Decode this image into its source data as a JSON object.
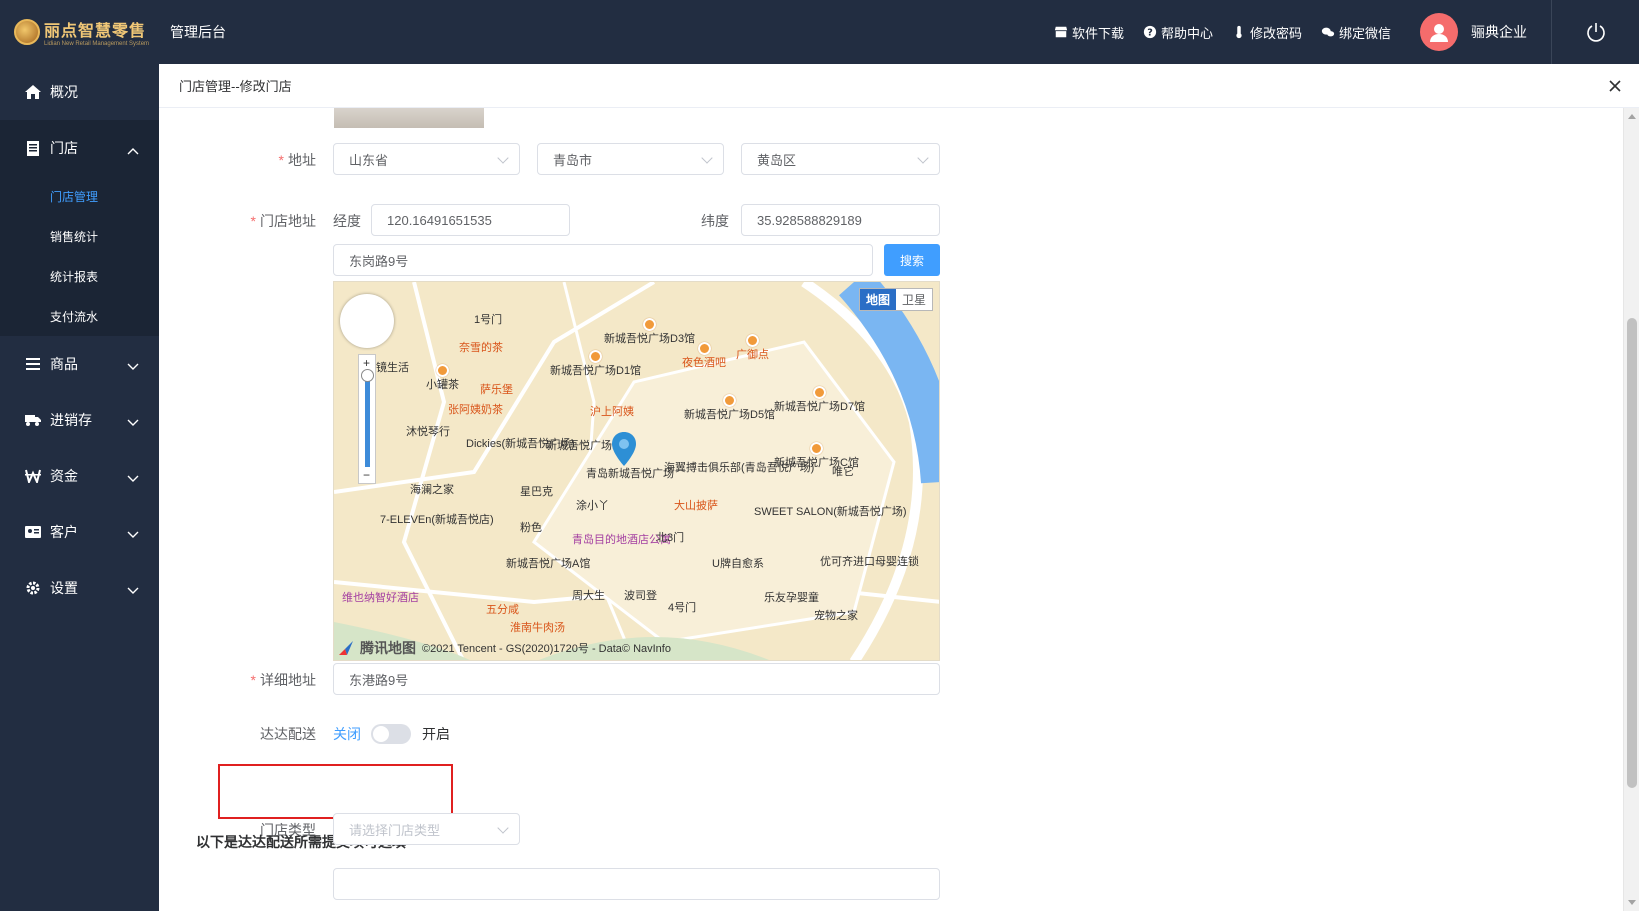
{
  "header": {
    "logo_title": "丽点智慧零售",
    "logo_subtitle": "Lidian New Retail Management System",
    "admin_title": "管理后台",
    "links": [
      {
        "label": "软件下载",
        "icon": "store-icon"
      },
      {
        "label": "帮助中心",
        "icon": "question-icon"
      },
      {
        "label": "修改密码",
        "icon": "thermometer-icon"
      },
      {
        "label": "绑定微信",
        "icon": "wechat-icon"
      }
    ],
    "company": "骊典企业"
  },
  "sidebar": {
    "items": [
      {
        "label": "概况",
        "icon": "home-icon"
      },
      {
        "label": "门店",
        "icon": "store-doc-icon",
        "open": true
      },
      {
        "label": "商品",
        "icon": "list-icon"
      },
      {
        "label": "进销存",
        "icon": "truck-icon"
      },
      {
        "label": "资金",
        "icon": "won-icon"
      },
      {
        "label": "客户",
        "icon": "id-card-icon"
      },
      {
        "label": "设置",
        "icon": "gear-icon"
      }
    ],
    "submenu": [
      {
        "label": "门店管理",
        "active": true
      },
      {
        "label": "销售统计"
      },
      {
        "label": "统计报表"
      },
      {
        "label": "支付流水"
      }
    ]
  },
  "panel": {
    "breadcrumb": "门店管理--修改门店",
    "address": {
      "label": "地址",
      "province": "山东省",
      "city": "青岛市",
      "district": "黄岛区"
    },
    "location": {
      "label": "门店地址",
      "lng_label": "经度",
      "lng_value": "120.16491651535",
      "lat_label": "纬度",
      "lat_value": "35.928588829189",
      "search_value": "东岗路9号",
      "search_button": "搜索"
    },
    "map": {
      "toggle_map": "地图",
      "toggle_sat": "卫星",
      "brand": "腾讯地图",
      "attribution": "©2021 Tencent - GS(2020)1720号 - Data© NavInfo",
      "pois": [
        "新城吾悦广场D3馆",
        "奈雪的茶",
        "夜色酒吧",
        "广御点",
        "镜生活",
        "小罐茶",
        "萨乐堡",
        "新城吾悦广场D1馆",
        "张阿姨奶茶",
        "沪上阿姨",
        "新城吾悦广场D5馆",
        "新城吾悦广场D7馆",
        "沐悦琴行",
        "Dickies(新城吾悦广场)",
        "新城吾悦广场B馆",
        "青岛新城吾悦广场",
        "海翼搏击俱乐部(青岛吾悦广场)",
        "新城吾悦广场C馆",
        "唯它",
        "海澜之家",
        "星巴克",
        "涂小丫",
        "大山披萨",
        "SWEET SALON(新城吾悦广场)",
        "7-ELEVEn(新城吾悦店)",
        "粉色",
        "青岛目的地酒店公寓",
        "北3门",
        "U牌自愈系",
        "优可齐进口母婴连锁",
        "新城吾悦广场A馆",
        "周大生",
        "波司登",
        "4号门",
        "乐友孕婴童",
        "宠物之家",
        "维也纳智好酒店",
        "五分咸",
        "淮南牛肉汤",
        "1号门"
      ]
    },
    "detail": {
      "label": "详细地址",
      "value": "东港路9号"
    },
    "dada": {
      "label": "达达配送",
      "off_label": "关闭",
      "on_label": "开启",
      "enabled": false
    },
    "section_note": "以下是达达配送所需提交项可选填",
    "store_type": {
      "label": "门店类型",
      "placeholder": "请选择门店类型"
    }
  }
}
